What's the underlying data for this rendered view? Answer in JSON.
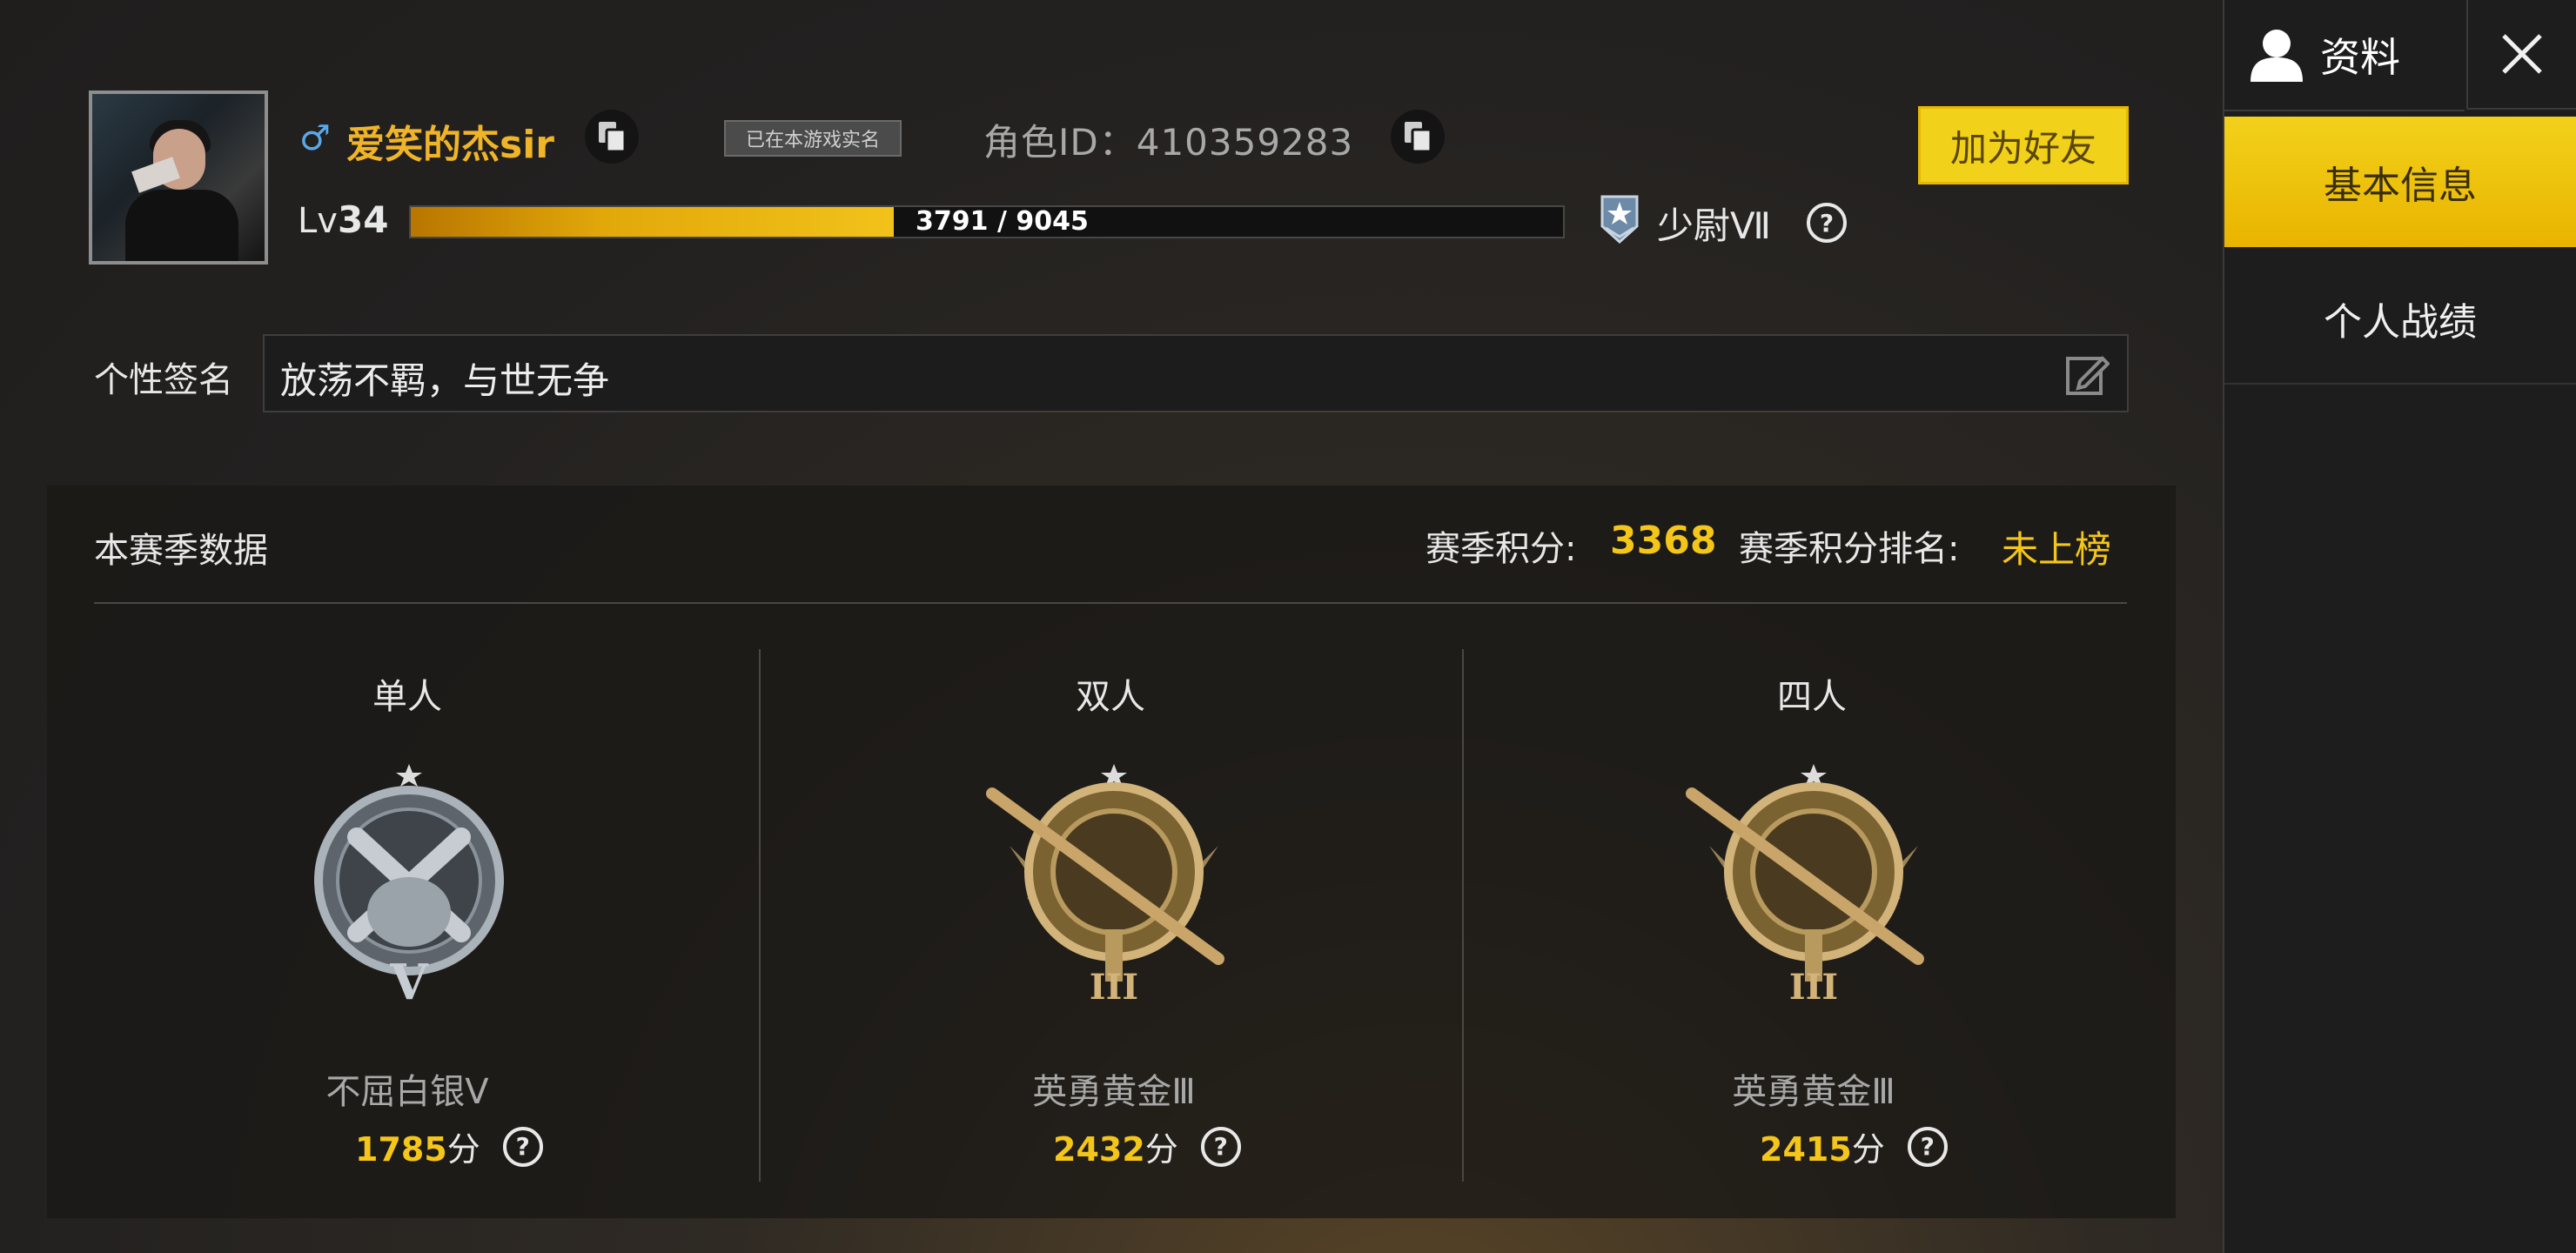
{
  "profile": {
    "gender_symbol": "♂",
    "username": "爱笑的杰sir",
    "realname_badge": "已在本游戏实名",
    "role_id": "角色ID：410359283",
    "add_friend": "加为好友",
    "level_prefix": "Lv",
    "level": "34",
    "xp_text": "3791 / 9045",
    "xp_fraction": 0.419,
    "rank": "少尉Ⅶ",
    "help_glyph": "?"
  },
  "signature": {
    "label": "个性签名",
    "text": "放荡不羁，与世无争"
  },
  "season": {
    "title": "本赛季数据",
    "score_label": "赛季积分:",
    "score_value": "3368",
    "rank_label": "赛季积分排名:",
    "rank_value": "未上榜",
    "modes": [
      {
        "name": "单人",
        "tier": "不屈白银Ⅴ",
        "points": "1785",
        "unit": "分",
        "badge": "silver-pistols-badge"
      },
      {
        "name": "双人",
        "tier": "英勇黄金Ⅲ",
        "points": "2432",
        "unit": "分",
        "badge": "gold-pan-rifle-badge"
      },
      {
        "name": "四人",
        "tier": "英勇黄金Ⅲ",
        "points": "2415",
        "unit": "分",
        "badge": "gold-pan-rifle-badge"
      }
    ]
  },
  "sidebar": {
    "header": "资料",
    "tabs": [
      {
        "label": "基本信息",
        "active": true
      },
      {
        "label": "个人战绩",
        "active": false
      }
    ]
  },
  "colors": {
    "accent": "#f2d11a",
    "gold_text": "#f5c61a",
    "name": "#f0b429"
  }
}
